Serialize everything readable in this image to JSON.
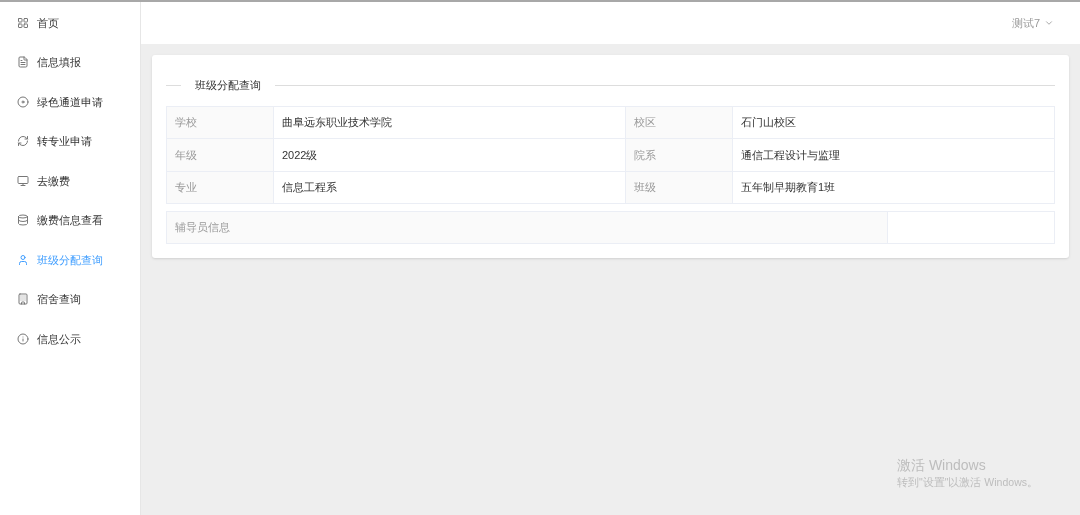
{
  "sidebar": {
    "items": [
      {
        "label": "首页",
        "selected": false
      },
      {
        "label": "信息填报",
        "selected": false
      },
      {
        "label": "绿色通道申请",
        "selected": false
      },
      {
        "label": "转专业申请",
        "selected": false
      },
      {
        "label": "去缴费",
        "selected": false
      },
      {
        "label": "缴费信息查看",
        "selected": false
      },
      {
        "label": "班级分配查询",
        "selected": true
      },
      {
        "label": "宿舍查询",
        "selected": false
      },
      {
        "label": "信息公示",
        "selected": false
      }
    ]
  },
  "header": {
    "user": "测试7"
  },
  "card": {
    "title": "班级分配查询",
    "rows": [
      {
        "label_1": "学校",
        "value_1": "曲阜远东职业技术学院",
        "label_2": "校区",
        "value_2": "石门山校区"
      },
      {
        "label_1": "年级",
        "value_1": "2022级",
        "label_2": "院系",
        "value_2": "通信工程设计与监理"
      },
      {
        "label_1": "专业",
        "value_1": "信息工程系",
        "label_2": "班级",
        "value_2": "五年制早期教育1班"
      }
    ],
    "counselor_label": "辅导员信息"
  },
  "os_notice": {
    "title": "激活 Windows",
    "subtitle": "转到\"设置\"以激活 Windows。"
  }
}
